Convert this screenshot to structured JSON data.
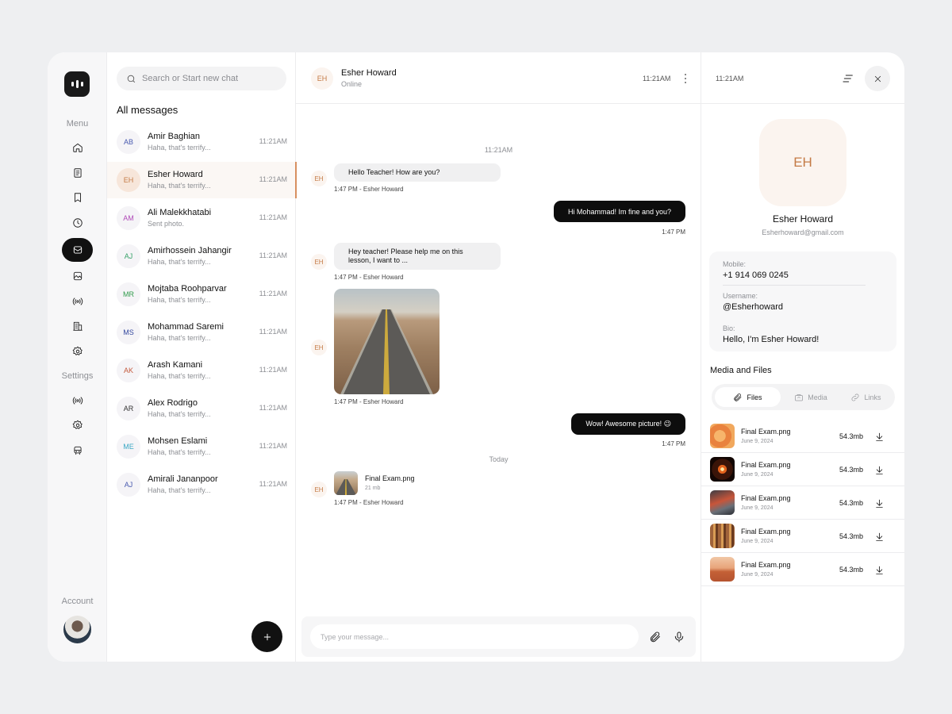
{
  "rail": {
    "menu_label": "Menu",
    "settings_label": "Settings",
    "account_label": "Account",
    "menu_items": [
      "home-icon",
      "document-icon",
      "bookmark-icon",
      "clock-icon",
      "messages-icon",
      "image-icon",
      "broadcast-icon",
      "building-icon",
      "gear-icon"
    ],
    "settings_items": [
      "broadcast-icon",
      "gear-icon",
      "bus-icon"
    ],
    "active_item": "messages-icon"
  },
  "chat_list": {
    "search_placeholder": "Search or Start new chat",
    "title": "All messages",
    "items": [
      {
        "initials": "AB",
        "name": "Amir Baghian",
        "preview": "Haha, that's terrify...",
        "time": "11:21AM",
        "color": "#4a5bb0",
        "active": false
      },
      {
        "initials": "EH",
        "name": "Esher Howard",
        "preview": "Haha, that's terrify...",
        "time": "11:21AM",
        "color": "#c47a45",
        "active": true
      },
      {
        "initials": "AM",
        "name": "Ali Malekkhatabi",
        "preview": "Sent photo.",
        "time": "11:21AM",
        "color": "#b049b8",
        "active": false
      },
      {
        "initials": "AJ",
        "name": "Amirhossein Jahangir",
        "preview": "Haha, that's terrify...",
        "time": "11:21AM",
        "color": "#3aa36b",
        "active": false
      },
      {
        "initials": "MR",
        "name": "Mojtaba Roohparvar",
        "preview": "Haha, that's terrify...",
        "time": "11:21AM",
        "color": "#2f9a4a",
        "active": false
      },
      {
        "initials": "MS",
        "name": "Mohammad Saremi",
        "preview": "Haha, that's terrify...",
        "time": "11:21AM",
        "color": "#33479e",
        "active": false
      },
      {
        "initials": "AK",
        "name": "Arash Kamani",
        "preview": "Haha, that's terrify...",
        "time": "11:21AM",
        "color": "#c45a3d",
        "active": false
      },
      {
        "initials": "AR",
        "name": "Alex Rodrigo",
        "preview": "Haha, that's terrify...",
        "time": "11:21AM",
        "color": "#333333",
        "active": false
      },
      {
        "initials": "ME",
        "name": "Mohsen Eslami",
        "preview": "Haha, that's terrify...",
        "time": "11:21AM",
        "color": "#3aa7c4",
        "active": false
      },
      {
        "initials": "AJ",
        "name": "Amirali Jananpoor",
        "preview": "Haha, that's terrify...",
        "time": "11:21AM",
        "color": "#4a5bb0",
        "active": false
      }
    ]
  },
  "conversation": {
    "contact_initials": "EH",
    "contact_name": "Esher Howard",
    "contact_status": "Online",
    "header_time": "11:21AM",
    "separator_time": "11:21AM",
    "separator_today": "Today",
    "messages": {
      "m1_text": "Hello Teacher! How are you?",
      "m1_meta": "1:47 PM - Esher Howard",
      "m2_text": "Hi Mohammad! Im fine and you?",
      "m2_meta": "1:47 PM",
      "m3_text": "Hey teacher! Please help me on this lesson, I want to ...",
      "m3_meta": "1:47 PM - Esher Howard",
      "m4_meta": "1:47 PM - Esher Howard",
      "m5_text": "Wow! Awesome picture! 😉",
      "m5_meta": "1:47 PM",
      "m6_file_name": "Final Exam.png",
      "m6_file_size": "21 mb",
      "m6_meta": "1:47 PM - Esher Howard"
    },
    "composer_placeholder": "Type your message..."
  },
  "profile": {
    "header_time": "11:21AM",
    "initials": "EH",
    "name": "Esher Howard",
    "email": "Esherhoward@gmail.com",
    "mobile_label": "Mobile:",
    "mobile": "+1 914 069 0245",
    "username_label": "Username:",
    "username": "@Esherhoward",
    "bio_label": "Bio:",
    "bio": "Hello, I'm Esher Howard!",
    "media_title": "Media and Files",
    "tabs": {
      "files": "Files",
      "media": "Media",
      "links": "Links",
      "active": "Files"
    },
    "files": [
      {
        "name": "Final Exam.png",
        "date": "June 9, 2024",
        "size": "54.3mb"
      },
      {
        "name": "Final Exam.png",
        "date": "June 9, 2024",
        "size": "54.3mb"
      },
      {
        "name": "Final Exam.png",
        "date": "June 9, 2024",
        "size": "54.3mb"
      },
      {
        "name": "Final Exam.png",
        "date": "June 9, 2024",
        "size": "54.3mb"
      },
      {
        "name": "Final Exam.png",
        "date": "June 9, 2024",
        "size": "54.3mb"
      }
    ]
  },
  "colors": {
    "accent": "#c47a45",
    "dark": "#111111",
    "active_row": "#fbf7f4"
  }
}
